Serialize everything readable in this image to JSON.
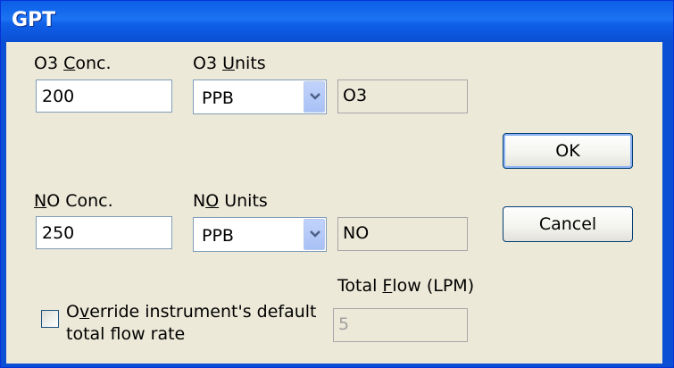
{
  "window": {
    "title": "GPT"
  },
  "o3": {
    "conc_label_pre": "O3 ",
    "conc_label_u": "C",
    "conc_label_post": "onc.",
    "conc_value": "200",
    "units_label_pre": "O3 ",
    "units_label_u": "U",
    "units_label_post": "nits",
    "units_value": "PPB",
    "gas_value": "O3"
  },
  "no": {
    "conc_label_pre": "",
    "conc_label_u": "N",
    "conc_label_post": "O Conc.",
    "conc_value": "250",
    "units_label_pre": "N",
    "units_label_u": "O",
    "units_label_post": " Units",
    "units_value": "PPB",
    "gas_value": "NO"
  },
  "flow": {
    "label_pre": "Total ",
    "label_u": "F",
    "label_post": "low (LPM)",
    "value": "5"
  },
  "override": {
    "label_pre": "O",
    "label_u": "v",
    "label_post": "erride instrument's default",
    "label_line2": "total flow rate",
    "checked": false
  },
  "buttons": {
    "ok": "OK",
    "cancel": "Cancel"
  },
  "icons": {
    "dropdown": "chevron-down-icon"
  }
}
